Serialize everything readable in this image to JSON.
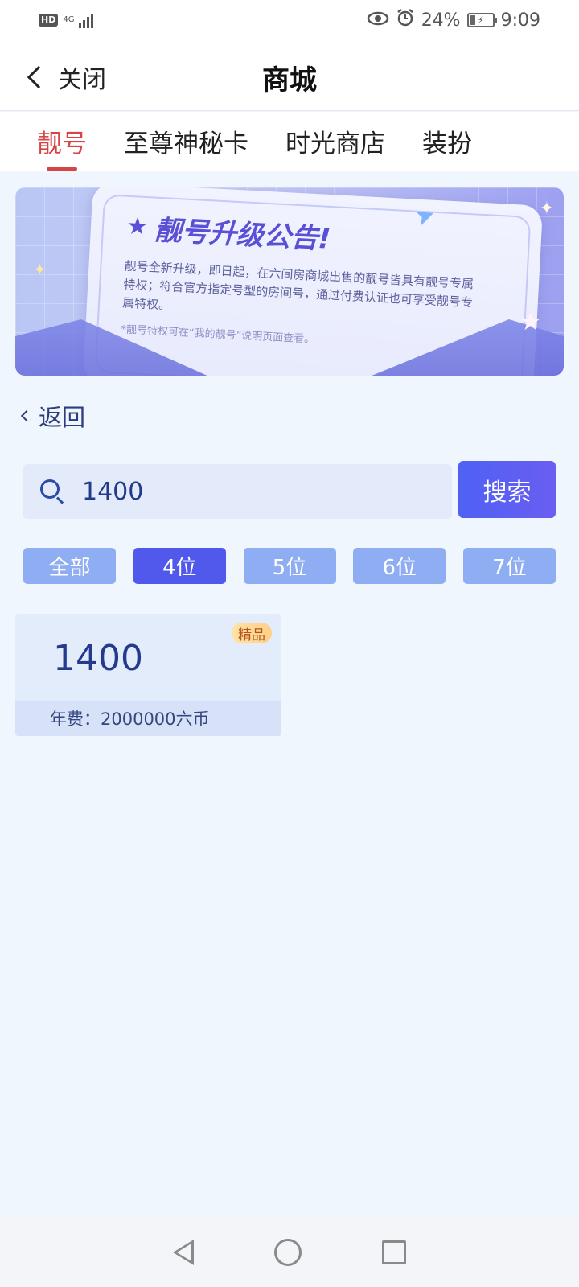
{
  "status_bar": {
    "hd": "HD",
    "network": "4G",
    "eye_icon": "eye-icon",
    "alarm_icon": "alarm-icon",
    "battery": "24%",
    "time": "9:09"
  },
  "header": {
    "back_label": "关闭",
    "title": "商城"
  },
  "tabs": [
    {
      "label": "靓号",
      "active": true
    },
    {
      "label": "至尊神秘卡",
      "active": false
    },
    {
      "label": "时光商店",
      "active": false
    },
    {
      "label": "装扮",
      "active": false
    }
  ],
  "banner": {
    "title": "靓号升级公告!",
    "body": "靓号全新升级，即日起，在六间房商城出售的靓号皆具有靓号专属特权；符合官方指定号型的房间号，通过付费认证也可享受靓号专属特权。",
    "note": "*靓号特权可在“我的靓号”说明页面查看。"
  },
  "back_link": {
    "label": "返回"
  },
  "search": {
    "value": "1400",
    "button_label": "搜索"
  },
  "filters": [
    {
      "label": "全部",
      "active": false
    },
    {
      "label": "4位",
      "active": true
    },
    {
      "label": "5位",
      "active": false
    },
    {
      "label": "6位",
      "active": false
    },
    {
      "label": "7位",
      "active": false
    }
  ],
  "results": [
    {
      "number": "1400",
      "badge": "精品",
      "fee": "年费：2000000六币"
    }
  ],
  "colors": {
    "accent_red": "#d84343",
    "primary_blue": "#5158ec",
    "filter_inactive": "#8fadf3",
    "page_bg": "#f0f6fd"
  }
}
